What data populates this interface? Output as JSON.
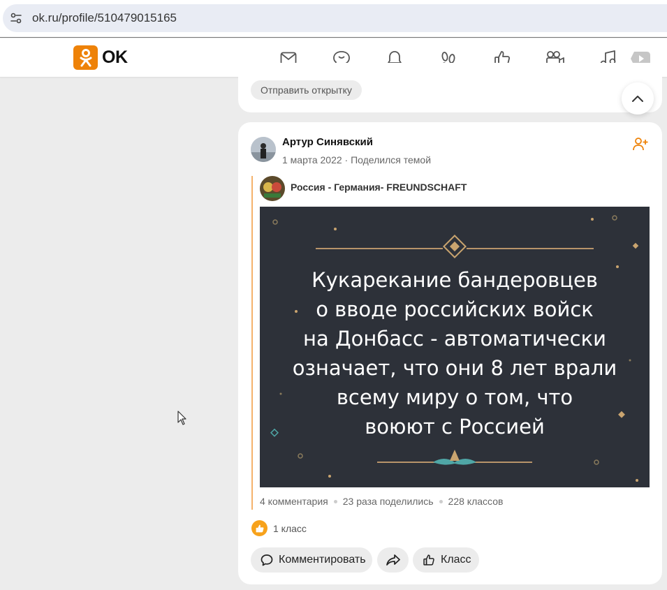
{
  "browser": {
    "url": "ok.ru/profile/510479015165"
  },
  "header": {
    "logo_text": "OK",
    "nav_icons": [
      "mail-icon",
      "chat-icon",
      "bell-icon",
      "guests-icon",
      "like-icon",
      "video-camera-icon",
      "music-icon",
      "video-icon"
    ]
  },
  "top_card": {
    "postcard_label": "Отправить открытку"
  },
  "post": {
    "author": "Артур Синявский",
    "meta": "1 марта 2022 · Поделился темой",
    "group_name": "Россия - Германия- FREUNDSCHAFT",
    "image_text_lines": [
      "Кукарекание бандеровцев",
      "о вводе российских войск",
      "на Донбасс - автоматически",
      "означает, что они 8 лет врали",
      "всему миру о том, что",
      "воюют с Россией"
    ],
    "stats": {
      "comments": "4 комментария",
      "shares": "23 раза поделились",
      "classes": "228 классов"
    },
    "like_count": "1 класс",
    "actions": {
      "comment": "Комментировать",
      "class": "Класс"
    }
  },
  "colors": {
    "brand_orange": "#ee8208",
    "page_bg": "#ececec",
    "image_bg": "#2d3139",
    "quote_bar": "#f5b26b"
  }
}
